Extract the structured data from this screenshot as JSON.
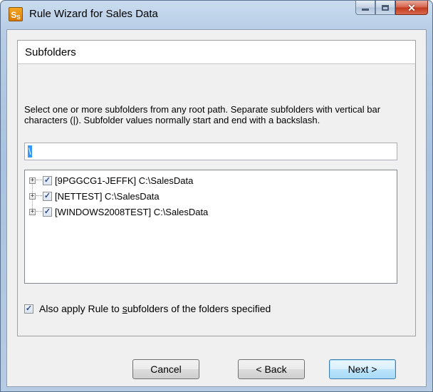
{
  "window": {
    "title": "Rule Wizard for Sales Data",
    "icon_name": "sales-app-icon",
    "icon_text": "S",
    "icon_sub": "S"
  },
  "panel": {
    "title": "Subfolders",
    "description": "Select one or more subfolders from any root path. Separate subfolders with vertical bar characters (|). Subfolder values normally start and end with a backslash.",
    "path_value": "\\"
  },
  "tree": {
    "items": [
      {
        "label": "[9PGGCG1-JEFFK] C:\\SalesData",
        "checked": true,
        "expanded": false
      },
      {
        "label": "[NETTEST] C:\\SalesData",
        "checked": true,
        "expanded": false
      },
      {
        "label": "[WINDOWS2008TEST] C:\\SalesData",
        "checked": true,
        "expanded": false
      }
    ]
  },
  "options": {
    "apply_subfolders_pre": "Also apply Rule to ",
    "apply_subfolders_ul": "s",
    "apply_subfolders_post": "ubfolders of the folders specified",
    "apply_subfolders_checked": true
  },
  "buttons": {
    "cancel": "Cancel",
    "back": "< Back",
    "next": "Next >"
  },
  "colors": {
    "selection": "#3399ff",
    "default_button_border": "#3c7fb1",
    "close_button": "#c2391d"
  }
}
